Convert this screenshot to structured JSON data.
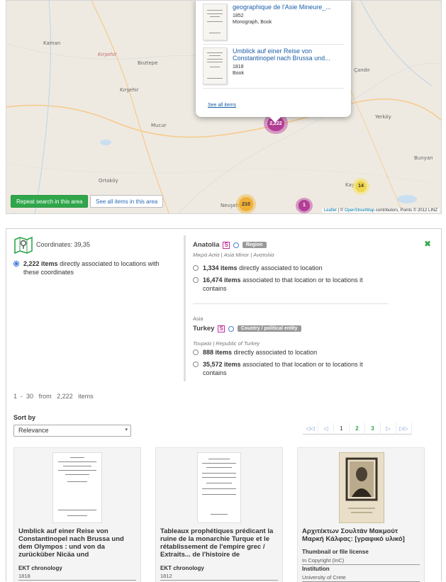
{
  "map": {
    "towns": [
      {
        "name": "Kırşehir",
        "italic": true
      },
      {
        "name": "Kaman",
        "italic": false
      },
      {
        "name": "Boztepe",
        "italic": false
      },
      {
        "name": "Kırşehir",
        "italic": false
      },
      {
        "name": "Mucur",
        "italic": false
      },
      {
        "name": "Ortaköy",
        "italic": false
      },
      {
        "name": "Nevşehir",
        "italic": false
      },
      {
        "name": "Çandır",
        "italic": false
      },
      {
        "name": "Yerköy",
        "italic": false
      },
      {
        "name": "Bunyan",
        "italic": false
      },
      {
        "name": "Kay",
        "italic": false
      }
    ],
    "clusters": [
      {
        "label": "2,222",
        "color": "purple"
      },
      {
        "label": "210",
        "color": "orange"
      },
      {
        "label": "14",
        "color": "yellow"
      },
      {
        "label": "1",
        "color": "purple"
      }
    ],
    "repeat_search_label": "Repeat search in this area",
    "see_all_label": "See all items in this area",
    "attribution": {
      "leaflet": "Leaflet",
      "sep": "| ©",
      "osm": "OpenStreetMap",
      "rest": "contributors, Points © 2012 LINZ"
    },
    "popup": {
      "items": [
        {
          "title": "geographique de l'Asie Mineure_...",
          "year": "1852",
          "type": "Monograph, Book"
        },
        {
          "title": "Umblick auf einer Reise von Constantinopel nach Brussa und...",
          "year": "1818",
          "type": "Book"
        }
      ],
      "see_all": "See all items"
    }
  },
  "panel": {
    "coordinates_label": "Coordinates: 39,35",
    "coord_option": {
      "count": "2,222",
      "items_word": "items",
      "text": "directly associated to locations with these coordinates"
    },
    "locations": [
      {
        "parent": "",
        "name": "Anatolia",
        "badge": "Region",
        "alt_names": "Μικρά Ασία | Asia Minor | Ανατολία",
        "options": [
          {
            "count": "1,334",
            "items_word": "items",
            "text": "directly associated to location"
          },
          {
            "count": "16,474",
            "items_word": "items",
            "text": "associated to that location or to locations it contains"
          }
        ]
      },
      {
        "parent": "Asia",
        "name": "Turkey",
        "badge": "Country / political entity",
        "alt_names": "Τουρκία | Republic of Turkey",
        "options": [
          {
            "count": "888",
            "items_word": "items",
            "text": "directly associated to location"
          },
          {
            "count": "35,572",
            "items_word": "items",
            "text": "associated to that location or to locations it contains"
          }
        ]
      }
    ],
    "close_icon": "✖"
  },
  "results": {
    "range_start": "1",
    "dash": "-",
    "range_end": "30",
    "from": "from",
    "total": "2,222",
    "items_word": "items",
    "sort_label": "Sort by",
    "sort_value": "Relevance",
    "pager": [
      "◁◁",
      "◁",
      "1",
      "2",
      "3",
      "▷",
      "▷▷"
    ]
  },
  "cards": [
    {
      "title": "Umblick auf einer Reise von Constantinopel nach Brussa und dem Olympos : und von da zurücküber Nicäa und",
      "field_label": "EKT chronology",
      "field_value": "1818"
    },
    {
      "title": "Tableaux prophétiques prédicant la ruine de la monarchie Turque et le rétablissement de l'empire grec / Extraits... de l'histoire de",
      "field_label": "EKT chronology",
      "field_value": "1812"
    },
    {
      "title": "Αρχιτέκτων Σουλτάν Μακμούτ Μαρκή Κάλφας: [γραφικό υλικό]",
      "field_label": "Thumbnail or file license",
      "field_value": "In Copyright (InC)",
      "field2_label": "Institution",
      "field2_value": "University of Crete"
    }
  ]
}
